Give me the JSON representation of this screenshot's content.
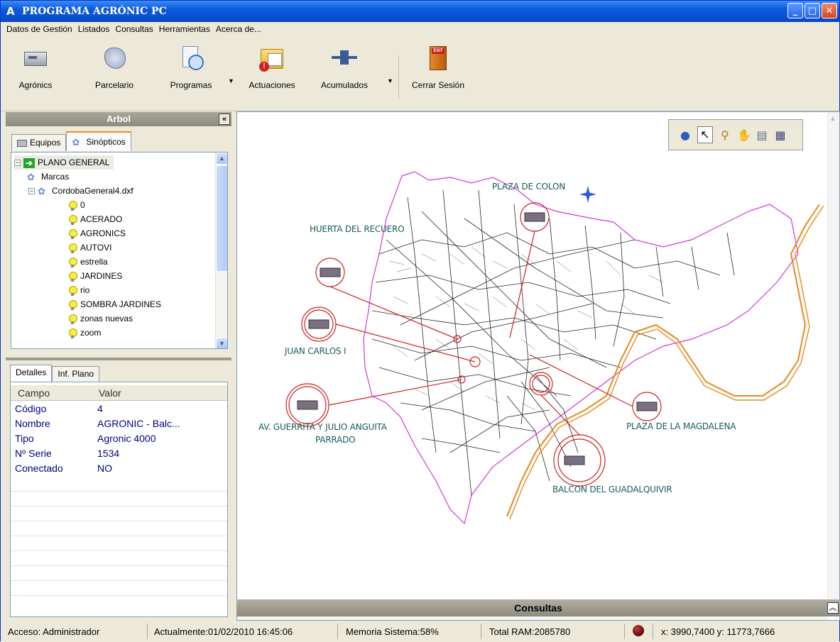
{
  "window": {
    "title": "PROGRAMA AGRÓNIC PC",
    "app_icon": "A"
  },
  "menu": [
    "Datos de Gestión",
    "Listados",
    "Consultas",
    "Herramientas",
    "Acerca de..."
  ],
  "toolbar": {
    "agronics": "Agrónics",
    "parcelario": "Parcelario",
    "programas": "Programas",
    "actuaciones": "Actuaciones",
    "acumulados": "Acumulados",
    "cerrar": "Cerrar Sesión",
    "exit_badge": "EXIT"
  },
  "left_panel": {
    "title": "Arbol",
    "collapse": "«",
    "tabs": [
      "Equipos",
      "Sinópticos"
    ],
    "tree": {
      "root": "PLANO GENERAL",
      "marcas": "Marcas",
      "file": "CordobaGeneral4.dxf",
      "layers": [
        "0",
        "ACERADO",
        "AGRONICS",
        "AUTOVI",
        "estrella",
        "JARDINES",
        "rio",
        "SOMBRA JARDINES",
        "zonas nuevas",
        "zoom"
      ]
    },
    "details_tabs": [
      "Detalles",
      "Inf. Plano"
    ],
    "grid_header": {
      "campo": "Campo",
      "valor": "Valor"
    },
    "grid_rows": [
      {
        "campo": "Código",
        "valor": "4"
      },
      {
        "campo": "Nombre",
        "valor": "AGRONIC - Balc..."
      },
      {
        "campo": "Tipo",
        "valor": "Agronic 4000"
      },
      {
        "campo": "Nº Serie",
        "valor": "1534"
      },
      {
        "campo": "Conectado",
        "valor": "NO"
      }
    ]
  },
  "map": {
    "labels": {
      "plaza_colon": "PLAZA DE COLON",
      "huerta": "HUERTA DEL RECUERO",
      "juan_carlos": "JUAN CARLOS I",
      "guerrita": "AV. GUERRITA Y JULIO ANGUITA",
      "parrado": "PARRADO",
      "magdalena": "PLAZA DE LA MAGDALENA",
      "balcon": "BALCON DEL GUADALQUIVIR"
    },
    "colors": {
      "streets": "#000000",
      "river": "#e8891e",
      "boundary": "#d03ad0",
      "marker": "#d02020",
      "device": "#7a7080"
    }
  },
  "consultas": {
    "title": "Consultas",
    "toggle": "«"
  },
  "status": {
    "acceso": "Acceso: Administrador",
    "fecha": "Actualmente:01/02/2010 16:45:06",
    "memoria": "Memoria Sistema:58%",
    "ram": "Total RAM:2085780",
    "coords": "x: 3990,7400  y: 11773,7666"
  }
}
